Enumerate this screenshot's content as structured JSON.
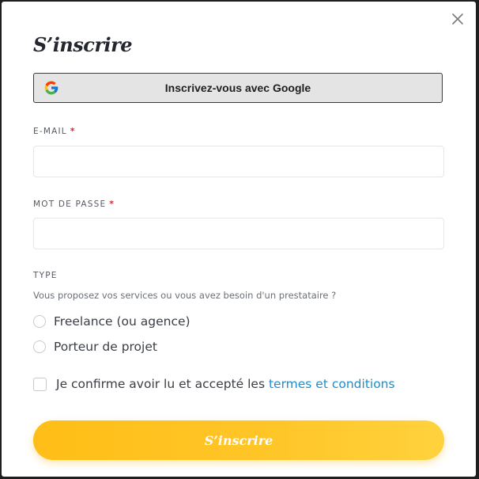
{
  "modal": {
    "title": "S’inscrire",
    "close_icon": "close-icon"
  },
  "google": {
    "label": "Inscrivez-vous avec Google",
    "icon": "google-icon"
  },
  "email": {
    "label": "E-MAIL",
    "required_mark": "*",
    "value": "",
    "placeholder": ""
  },
  "password": {
    "label": "MOT DE PASSE",
    "required_mark": "*",
    "value": "",
    "placeholder": ""
  },
  "type": {
    "label": "TYPE",
    "hint": "Vous proposez vos services ou vous avez besoin d'un prestataire ?",
    "options": [
      {
        "label": "Freelance (ou agence)",
        "selected": false
      },
      {
        "label": "Porteur de projet",
        "selected": false
      }
    ]
  },
  "terms": {
    "text": "Je confirme avoir lu et accepté les ",
    "link_text": "termes et conditions",
    "checked": false
  },
  "submit": {
    "label": "S’inscrire"
  },
  "colors": {
    "accent": "#ffc629",
    "link": "#1a8ed1",
    "required": "#e0202a",
    "title": "#23272f"
  }
}
